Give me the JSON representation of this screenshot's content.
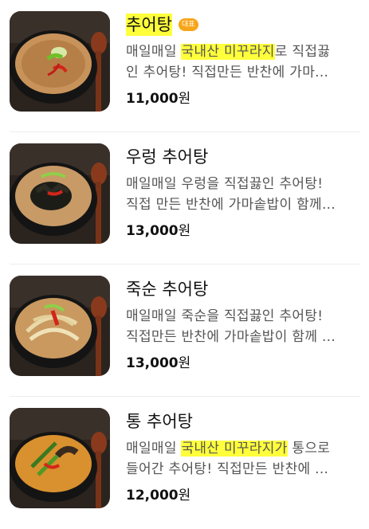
{
  "menu": {
    "items": [
      {
        "name": "추어탕",
        "badge": "대표",
        "desc_line1_pre": "매일매일 ",
        "desc_line1_hl": "국내산 미꾸라지",
        "desc_line1_post": "로 직접끓",
        "desc_line2": "인 추어탕! 직접만든 반찬에 가마...",
        "price_num": "11,000",
        "price_unit": "원",
        "image_icon": "bowl-chueotang"
      },
      {
        "name": "우렁 추어탕",
        "desc_line1_pre": "매일매일 우렁을 직접끓인 추어탕!",
        "desc_line2": "직접 만든 반찬에 가마솥밥이 함께...",
        "price_num": "13,000",
        "price_unit": "원",
        "image_icon": "bowl-snail-chueotang"
      },
      {
        "name": "죽순 추어탕",
        "desc_line1_pre": "매일매일 죽순을 직접끓인 추어탕!",
        "desc_line2": "직접만든 반찬에 가마솥밥이 함께 ...",
        "price_num": "13,000",
        "price_unit": "원",
        "image_icon": "bowl-bamboo-chueotang"
      },
      {
        "name": "통 추어탕",
        "desc_line1_pre": "매일매일 ",
        "desc_line1_hl": "국내산 미꾸라지가",
        "desc_line1_post": " 통으로",
        "desc_line2": "들어간 추어탕! 직접만든 반찬에 ...",
        "price_num": "12,000",
        "price_unit": "원",
        "image_icon": "bowl-whole-chueotang"
      }
    ]
  },
  "colors": {
    "highlight": "#ffff3b",
    "badge": "#f7a518"
  }
}
